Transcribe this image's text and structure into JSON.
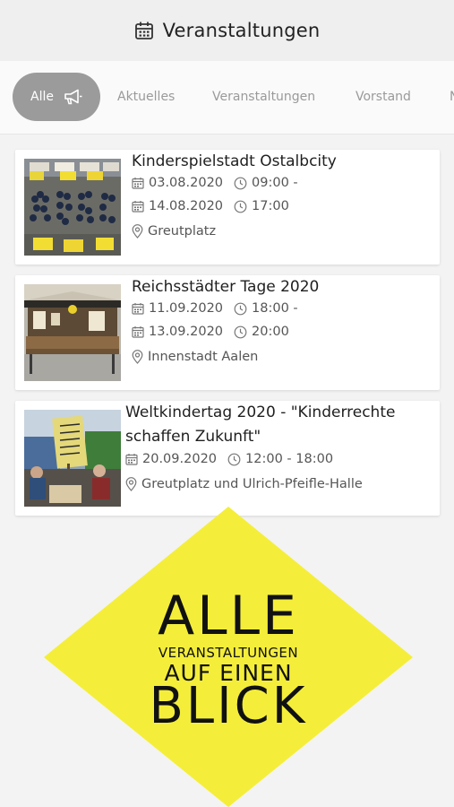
{
  "header": {
    "title": "Veranstaltungen",
    "icon": "calendar-icon"
  },
  "tabs": [
    {
      "label": "Alle",
      "active": true,
      "icon": "megaphone-icon"
    },
    {
      "label": "Aktuelles",
      "active": false
    },
    {
      "label": "Veranstaltungen",
      "active": false
    },
    {
      "label": "Vorstand",
      "active": false
    },
    {
      "label": "N",
      "active": false
    }
  ],
  "events": [
    {
      "title": "Kinderspielstadt Ostalbcity",
      "start_date": "03.08.2020",
      "start_time": "09:00 -",
      "end_date": "14.08.2020",
      "end_time": "17:00",
      "location": "Greutplatz"
    },
    {
      "title": "Reichsstädter Tage 2020",
      "start_date": "11.09.2020",
      "start_time": "18:00 -",
      "end_date": "13.09.2020",
      "end_time": "20:00",
      "location": "Innenstadt Aalen"
    },
    {
      "title_line1": "Weltkindertag 2020 - \"Kinderrechte",
      "title_line2": "schaffen Zukunft\"",
      "date": "20.09.2020",
      "time": "12:00 - 18:00",
      "location": "Greutplatz und Ulrich-Pfeifle-Halle"
    }
  ],
  "promo": {
    "line1": "ALLE",
    "line2": "VERANSTALTUNGEN",
    "line3": "AUF EINEN",
    "line4": "BLICK",
    "color": "#f4ee3a"
  },
  "colors": {
    "accent_tab": "#9b9b9b",
    "background": "#f3f3f3"
  }
}
